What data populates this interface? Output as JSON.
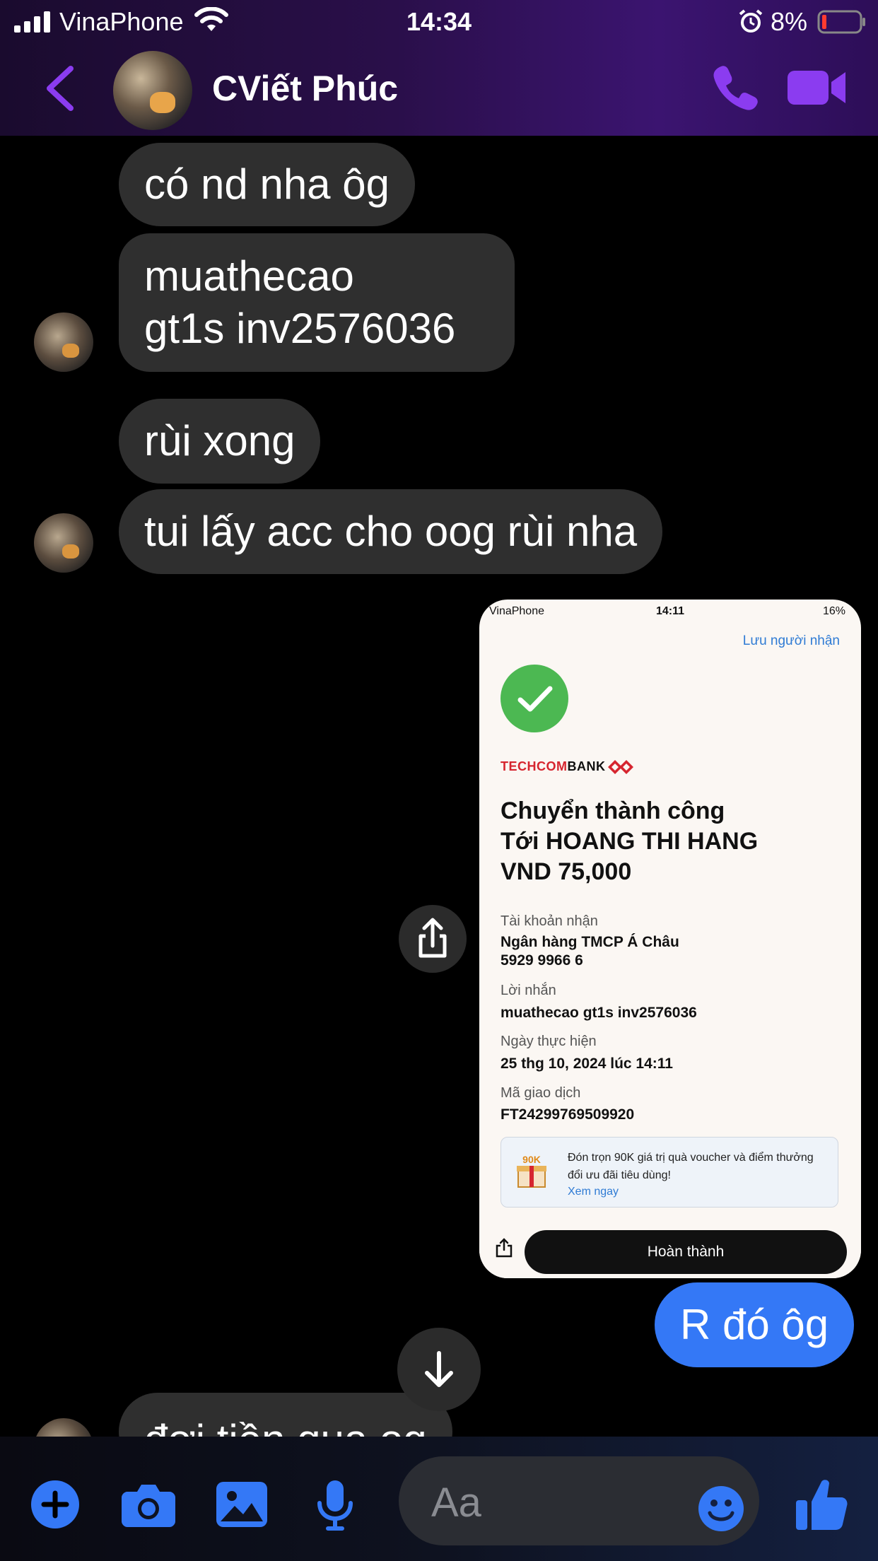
{
  "status_bar": {
    "carrier": "VinaPhone",
    "time": "14:34",
    "battery_percent": "8%"
  },
  "header": {
    "contact_name": "CViết Phúc"
  },
  "messages": {
    "m1": "có nd nha ôg",
    "m2_line1": "muathecao",
    "m2_line2": "gt1s inv2576036",
    "m3": "rùi xong",
    "m4": "tui lấy acc cho oog rùi nha",
    "mine": "R đó ôg",
    "m5": "đợi tiền qua og"
  },
  "attachment": {
    "status_carrier": "VinaPhone",
    "status_time": "14:11",
    "status_battery": "16%",
    "save_recipient": "Lưu người nhận",
    "bank_logo_part1": "TECHCOM",
    "bank_logo_part2": "BANK",
    "title_line1": "Chuyển thành công",
    "title_line2": "Tới HOANG THI HANG",
    "title_line3": "VND 75,000",
    "account_label": "Tài khoản nhận",
    "account_bank": "Ngân hàng TMCP Á Châu",
    "account_number": "5929 9966 6",
    "message_label": "Lời nhắn",
    "message_value": "muathecao gt1s inv2576036",
    "date_label": "Ngày thực hiện",
    "date_value": "25 thg 10, 2024 lúc 14:11",
    "txn_label": "Mã giao dịch",
    "txn_value": "FT24299769509920",
    "promo_badge": "90K",
    "promo_text": "Đón trọn 90K giá trị quà voucher và điểm thưởng đổi ưu đãi tiêu dùng!",
    "promo_link": "Xem ngay",
    "done_button": "Hoàn thành"
  },
  "composer": {
    "placeholder": "Aa"
  },
  "colors": {
    "accent_purple": "#8b3cf0",
    "accent_blue": "#3478f6",
    "incoming_bubble": "#2f2f2f",
    "success_green": "#4cb852",
    "bank_red": "#d6252f"
  },
  "icons": {
    "back": "chevron-left-icon",
    "call": "phone-icon",
    "video": "video-camera-icon",
    "share": "share-icon",
    "scroll_down": "arrow-down-icon",
    "plus": "plus-icon",
    "camera": "camera-icon",
    "gallery": "image-icon",
    "mic": "microphone-icon",
    "emoji": "emoji-icon",
    "like": "thumbs-up-icon"
  }
}
